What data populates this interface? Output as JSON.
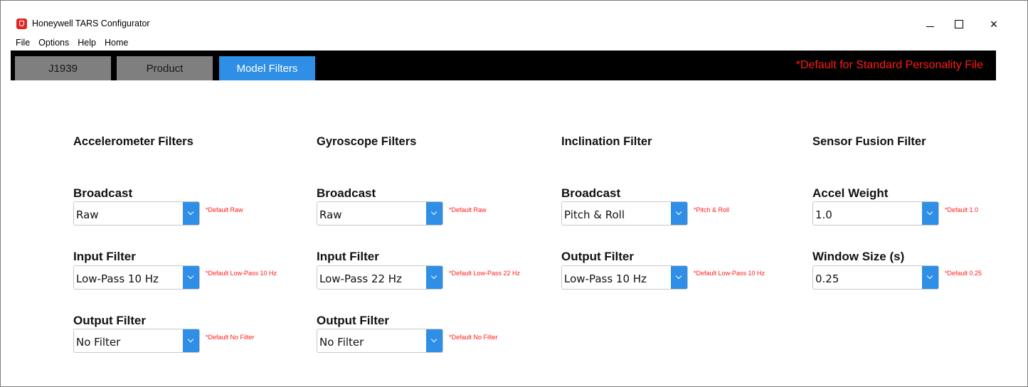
{
  "window": {
    "title": "Honeywell TARS Configurator",
    "controls": {
      "minimize": "minimize",
      "maximize": "maximize",
      "close": "×"
    }
  },
  "menu": [
    "File",
    "Options",
    "Help",
    "Home"
  ],
  "tabs": [
    {
      "label": "J1939",
      "active": false
    },
    {
      "label": "Product",
      "active": false
    },
    {
      "label": "Model Filters",
      "active": true
    }
  ],
  "notice": "*Default for Standard Personality File",
  "sections": {
    "accelerometer": {
      "title": "Accelerometer Filters",
      "broadcast": {
        "label": "Broadcast",
        "value": "Raw",
        "hint": "*Default Raw"
      },
      "input_filter": {
        "label": "Input Filter",
        "value": "Low-Pass 10 Hz",
        "hint": "*Default Low-Pass 10 Hz"
      },
      "output_filter": {
        "label": "Output Filter",
        "value": "No Filter",
        "hint": "*Default No Filter"
      }
    },
    "gyroscope": {
      "title": "Gyroscope Filters",
      "broadcast": {
        "label": "Broadcast",
        "value": "Raw",
        "hint": "*Default Raw"
      },
      "input_filter": {
        "label": "Input Filter",
        "value": "Low-Pass 22 Hz",
        "hint": "*Default Low-Pass 22 Hz"
      },
      "output_filter": {
        "label": "Output Filter",
        "value": "No Filter",
        "hint": "*Default No Filter"
      }
    },
    "inclination": {
      "title": "Inclination Filter",
      "broadcast": {
        "label": "Broadcast",
        "value": "Pitch & Roll",
        "hint": "*Pitch & Roll"
      },
      "output_filter": {
        "label": "Output Filter",
        "value": "Low-Pass 10 Hz",
        "hint": "*Default Low-Pass 10 Hz"
      }
    },
    "sensor_fusion": {
      "title": "Sensor Fusion Filter",
      "accel_weight": {
        "label": "Accel Weight",
        "value": "1.0",
        "hint": "*Default 1.0"
      },
      "window_size": {
        "label": "Window Size (s)",
        "value": "0.25",
        "hint": "*Default 0.25"
      }
    }
  },
  "colors": {
    "accent": "#2f8fe6",
    "tab_inactive": "#7f7f7f",
    "tabbar": "#000000",
    "hint": "#ff1a1a"
  }
}
